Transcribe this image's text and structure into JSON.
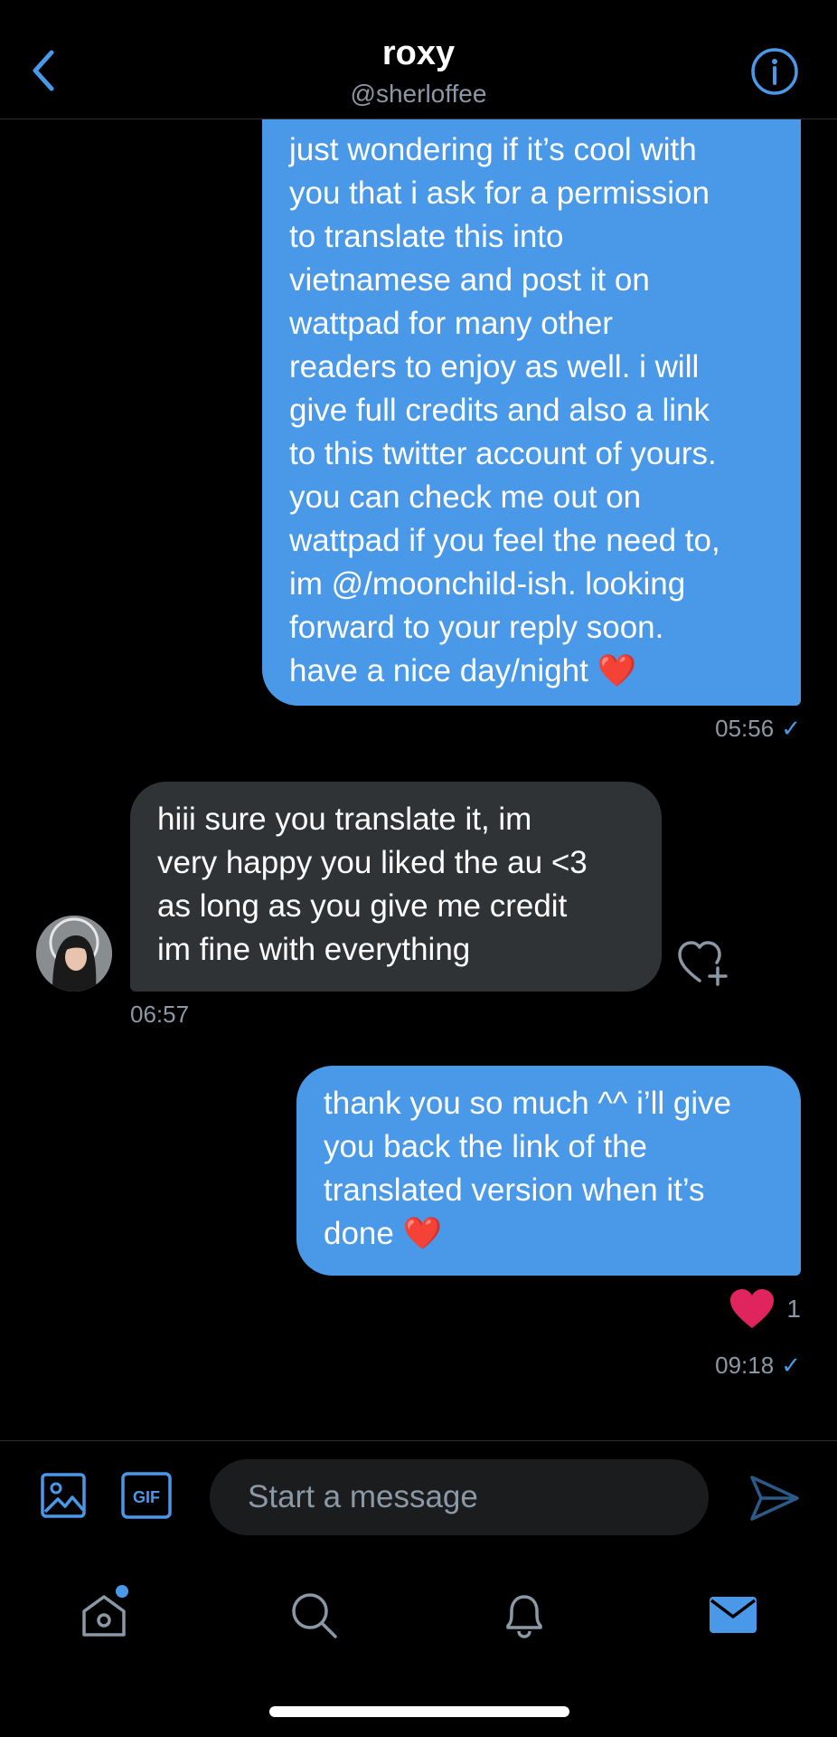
{
  "header": {
    "name": "roxy",
    "handle": "@sherloffee"
  },
  "messages": [
    {
      "direction": "outgoing",
      "lines": [
        "just wondering if it’s cool with",
        "you that i ask for a permission",
        "to translate this into",
        "vietnamese and post it on",
        "wattpad for many other",
        "readers to enjoy as well. i will",
        "give full credits and also a link",
        "to this twitter account of yours.",
        "you can check me out on",
        "wattpad if you feel the need to,",
        "im @/moonchild-ish. looking",
        "forward to your reply soon.",
        "have a nice day/night ❤️"
      ],
      "time": "05:56",
      "read_mark": "✓"
    },
    {
      "direction": "incoming",
      "lines": [
        "hiii sure you translate it, im",
        "very happy you liked the au <3",
        "as long as you give me credit",
        "im fine with everything"
      ],
      "time": "06:57"
    },
    {
      "direction": "outgoing",
      "lines": [
        "thank you so much ^^ i’ll give",
        "you back the link of the",
        "translated version when it’s",
        "done ❤️"
      ],
      "like_count": "1",
      "time": "09:18",
      "read_mark": "✓"
    }
  ],
  "composer": {
    "placeholder": "Start a message",
    "gif_label": "GIF"
  },
  "tabbar": {
    "items": [
      "home-icon",
      "search-icon",
      "notifications-icon",
      "messages-icon"
    ],
    "active": "messages-icon"
  },
  "colors": {
    "accent": "#4a99e9",
    "background": "#000000",
    "incoming_bubble": "#2f3336",
    "like_red": "#e0245e",
    "muted_text": "#8b98a5"
  }
}
